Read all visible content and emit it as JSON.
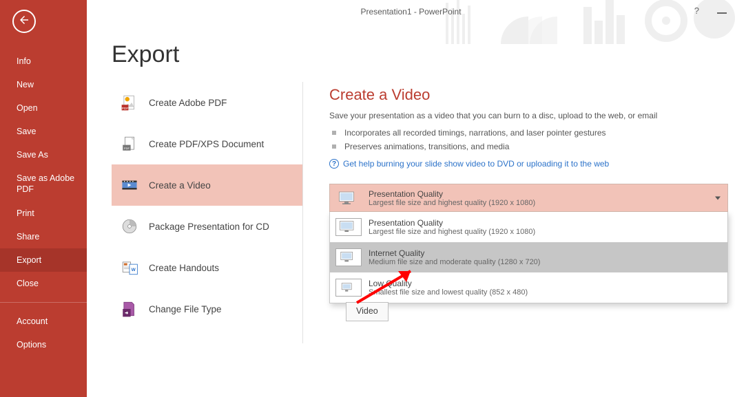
{
  "window": {
    "title": "Presentation1 - PowerPoint"
  },
  "sidebar": {
    "items": [
      {
        "label": "Info"
      },
      {
        "label": "New"
      },
      {
        "label": "Open"
      },
      {
        "label": "Save"
      },
      {
        "label": "Save As"
      },
      {
        "label": "Save as Adobe PDF"
      },
      {
        "label": "Print"
      },
      {
        "label": "Share"
      },
      {
        "label": "Export"
      },
      {
        "label": "Close"
      }
    ],
    "footerItems": [
      {
        "label": "Account"
      },
      {
        "label": "Options"
      }
    ]
  },
  "page": {
    "title": "Export"
  },
  "categories": [
    {
      "icon": "adobe-pdf-icon",
      "label": "Create Adobe PDF"
    },
    {
      "icon": "pdf-xps-icon",
      "label": "Create PDF/XPS Document"
    },
    {
      "icon": "video-icon",
      "label": "Create a Video"
    },
    {
      "icon": "cd-icon",
      "label": "Package Presentation for CD"
    },
    {
      "icon": "handouts-icon",
      "label": "Create Handouts"
    },
    {
      "icon": "filetype-icon",
      "label": "Change File Type"
    }
  ],
  "details": {
    "title": "Create a Video",
    "subtitle": "Save your presentation as a video that you can burn to a disc, upload to the web, or email",
    "bullets": [
      "Incorporates all recorded timings, narrations, and laser pointer gestures",
      "Preserves animations, transitions, and media"
    ],
    "helpLink": "Get help burning your slide show video to DVD or uploading it to the web"
  },
  "qualitySelector": {
    "selected": {
      "title": "Presentation Quality",
      "desc": "Largest file size and highest quality (1920 x 1080)"
    },
    "options": [
      {
        "title": "Presentation Quality",
        "desc": "Largest file size and highest quality (1920 x 1080)"
      },
      {
        "title": "Internet Quality",
        "desc": "Medium file size and moderate quality (1280 x 720)"
      },
      {
        "title": "Low Quality",
        "desc": "Smallest file size and lowest quality (852 x 480)"
      }
    ]
  },
  "actionButton": {
    "label": "Video"
  }
}
